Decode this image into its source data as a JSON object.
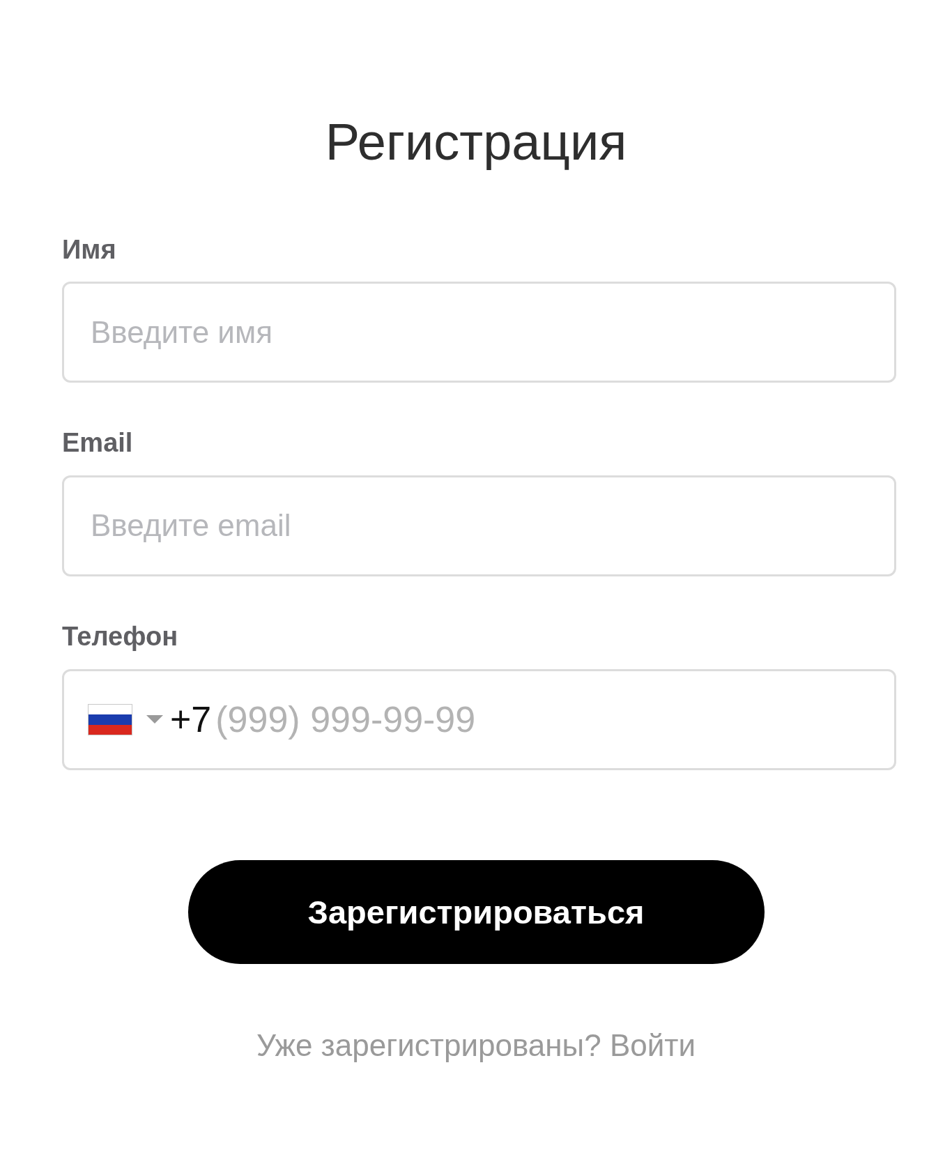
{
  "title": "Регистрация",
  "fields": [
    {
      "kind": "text",
      "label": "Имя",
      "placeholder": "Введите имя"
    },
    {
      "kind": "text",
      "label": "Email",
      "placeholder": "Введите email"
    },
    {
      "kind": "phone",
      "label": "Телефон",
      "country_code": "+7",
      "placeholder": "(999) 999-99-99"
    }
  ],
  "submit_button": "Зарегистрироваться",
  "login_link": "Уже зарегистрированы? Войти"
}
